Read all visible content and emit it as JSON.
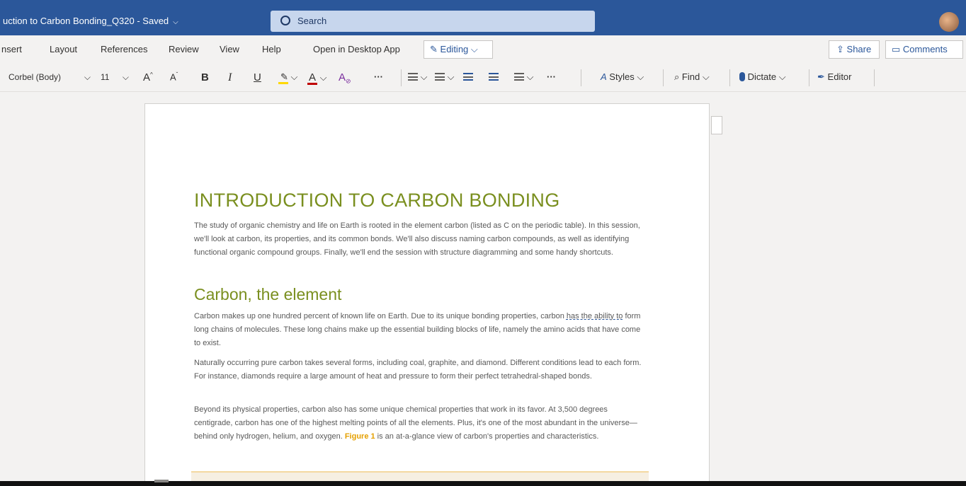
{
  "titlebar": {
    "doc_title": "uction to Carbon Bonding_Q320 - Saved",
    "search_placeholder": "Search"
  },
  "menu": {
    "items": [
      "nsert",
      "Layout",
      "References",
      "Review",
      "View",
      "Help",
      "Open in Desktop App"
    ],
    "editing": "Editing",
    "share": "Share",
    "comments": "Comments"
  },
  "toolbar": {
    "font": "Corbel (Body)",
    "size": "11",
    "grow": "A",
    "shrink": "A",
    "bold": "B",
    "italic": "I",
    "underline": "U",
    "font_color": "A",
    "clear_format": "A",
    "more": "···",
    "more2": "···",
    "styles": "Styles",
    "find": "Find",
    "dictate": "Dictate",
    "editor": "Editor"
  },
  "document": {
    "heading": "INTRODUCTION TO CARBON BONDING",
    "intro": "The study of organic chemistry and life on Earth is rooted in the element carbon (listed as C on the periodic table). In this session, we'll look at carbon, its properties, and its common bonds. We'll also discuss naming carbon compounds, as well as identifying functional organic compound groups. Finally, we'll end the session with structure diagramming and some handy shortcuts.",
    "subheading": "Carbon, the element",
    "p1_start": "Carbon makes up one hundred percent of known life on Earth. Due to its unique bonding properties, carbon ",
    "p1_squiggle": "has the ability to",
    "p1_end": " form long chains of molecules. These long chains make up the essential building blocks of life, namely the amino acids that have come to exist.",
    "p2": "Naturally occurring pure carbon takes several forms, including coal, graphite, and diamond. Different conditions lead to each form. For instance, diamonds require a large amount of heat and pressure to form their perfect tetrahedral-shaped bonds.",
    "p3_start": "Beyond its physical properties, carbon also has some unique chemical properties that work in its favor. At 3,500 degrees centigrade, carbon has one of the highest melting points of all the elements. Plus, it's one of the most abundant in the universe—behind only hydrogen, helium, and oxygen. ",
    "p3_figure": "Figure 1",
    "p3_end": " is an at-a-glance view of carbon's properties and characteristics."
  },
  "colors": {
    "ribbon": "#2b579a",
    "heading": "#7a8f1f",
    "figure_ref": "#e5a000"
  }
}
